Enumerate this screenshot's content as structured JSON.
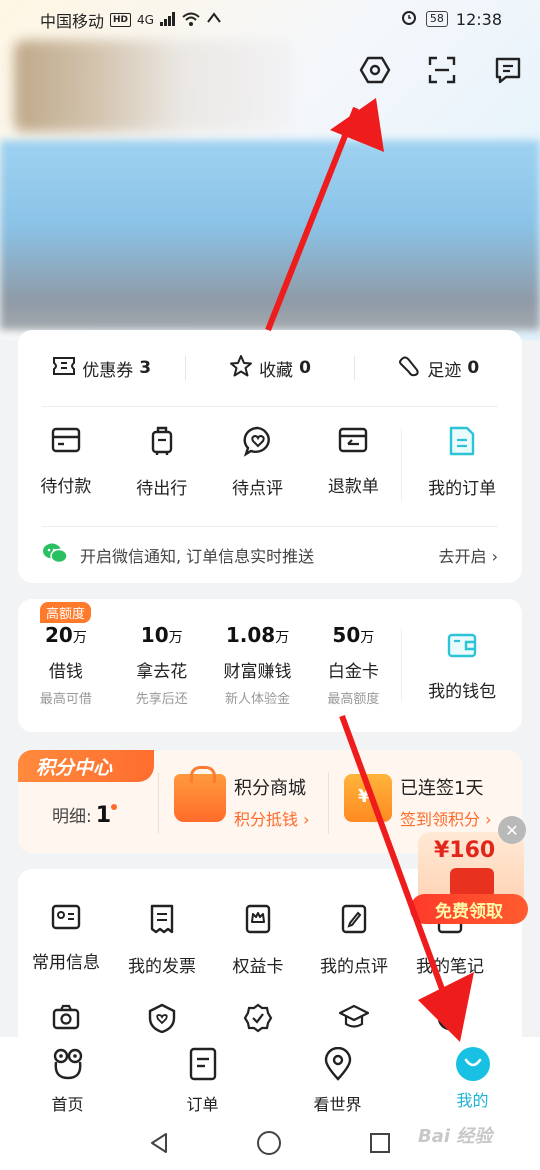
{
  "status_bar": {
    "carrier": "中国移动",
    "hd": "HD",
    "network": "4G",
    "battery": "58",
    "time": "12:38"
  },
  "header": {
    "icons": [
      "settings-hex-icon",
      "scan-icon",
      "message-icon"
    ]
  },
  "quick_stats": [
    {
      "label": "优惠券",
      "count": "3",
      "icon": "coupon-icon"
    },
    {
      "label": "收藏",
      "count": "0",
      "icon": "star-icon"
    },
    {
      "label": "足迹",
      "count": "0",
      "icon": "footprint-icon"
    }
  ],
  "orders": {
    "items": [
      {
        "label": "待付款",
        "icon": "card-icon"
      },
      {
        "label": "待出行",
        "icon": "luggage-icon"
      },
      {
        "label": "待点评",
        "icon": "comment-heart-icon"
      },
      {
        "label": "退款单",
        "icon": "refund-icon"
      }
    ],
    "my_orders": "我的订单"
  },
  "notify": {
    "text": "开启微信通知, 订单信息实时推送",
    "action": "去开启 ›"
  },
  "wallet": {
    "badge": "高额度",
    "items": [
      {
        "num": "20",
        "unit": "万",
        "name": "借钱",
        "sub": "最高可借"
      },
      {
        "num": "10",
        "unit": "万",
        "name": "拿去花",
        "sub": "先享后还"
      },
      {
        "num": "1.08",
        "unit": "万",
        "name": "财富赚钱",
        "sub": "新人体验金"
      },
      {
        "num": "50",
        "unit": "万",
        "name": "白金卡",
        "sub": "最高额度"
      }
    ],
    "my_wallet": "我的钱包"
  },
  "points": {
    "tag": "积分中心",
    "detail_label": "明细:",
    "detail_value": "1",
    "mall_title": "积分商城",
    "mall_sub": "积分抵钱 ›",
    "sign_title": "已连签1天",
    "sign_sub": "签到领积分 ›"
  },
  "services": {
    "row1": [
      {
        "label": "常用信息",
        "icon": "id-card-icon"
      },
      {
        "label": "我的发票",
        "icon": "receipt-icon"
      },
      {
        "label": "权益卡",
        "icon": "crown-card-icon"
      },
      {
        "label": "我的点评",
        "icon": "edit-note-icon"
      },
      {
        "label": "我的笔记",
        "icon": "note-icon"
      }
    ],
    "row2": [
      "camera-icon",
      "shield-heart-icon",
      "badge-check-icon",
      "graduation-cap-icon",
      "circle-icon"
    ]
  },
  "promo": {
    "amount": "¥160",
    "button": "免费领取"
  },
  "tabs": [
    {
      "label": "首页",
      "icon": "home-face-icon"
    },
    {
      "label": "订单",
      "icon": "order-doc-icon"
    },
    {
      "label": "看世界",
      "icon": "location-pin-icon"
    },
    {
      "label": "我的",
      "icon": "profile-smile-icon",
      "active": true
    }
  ],
  "watermark": "Bai 经验",
  "colors": {
    "accent": "#18c0e3",
    "orange": "#ff6a2b",
    "arrow": "#ee1c1c"
  }
}
